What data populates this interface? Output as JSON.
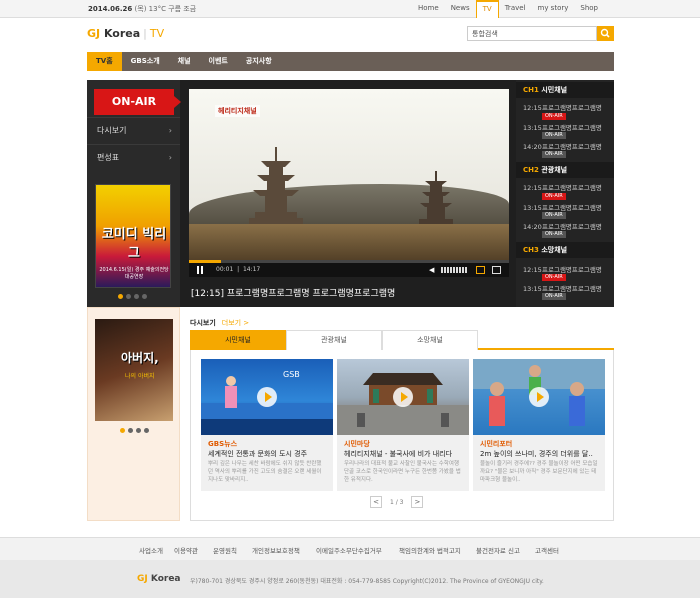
{
  "topbar": {
    "date": "2014.06.26",
    "weather": "(목) 13°C 구름 조금",
    "nav": [
      "Home",
      "News",
      "TV",
      "Travel",
      "my story",
      "Shop"
    ],
    "active": "TV"
  },
  "header": {
    "logo_gj": "GJ",
    "logo_korea": "Korea",
    "logo_sep": "|",
    "logo_tv": "TV",
    "search_placeholder": "통합검색"
  },
  "gnb": [
    "TV홈",
    "GBS소개",
    "채널",
    "이벤트",
    "공지사항"
  ],
  "player": {
    "onair_label": "ON-AIR",
    "menu": [
      "다시보기",
      "편성표"
    ],
    "arrow": "›",
    "poster_title": "코미디 빅리그",
    "poster_info": "2014.6.15(일) 경주 예술의전당 대공연장",
    "video_watermark": "헤리티지채널",
    "current_time": "00:01",
    "total_time": "14:17",
    "progress": 0.1,
    "now_title": "[12:15] 프로그램명프로그램명 프로그램명프로그램명"
  },
  "schedule": [
    {
      "ch": "CH1",
      "name": "시민채널",
      "items": [
        {
          "time": "12:15",
          "title": "프로그램명프로그램명",
          "badge": "ON-AIR",
          "live": true
        },
        {
          "time": "13:15",
          "title": "프로그램명프로그램명",
          "badge": "ON-AIR",
          "live": false
        },
        {
          "time": "14:20",
          "title": "프로그램명프로그램명",
          "badge": "ON-AIR",
          "live": false
        }
      ]
    },
    {
      "ch": "CH2",
      "name": "관광채널",
      "items": [
        {
          "time": "12:15",
          "title": "프로그램명프로그램명",
          "badge": "ON-AIR",
          "live": true
        },
        {
          "time": "13:15",
          "title": "프로그램명프로그램명",
          "badge": "ON-AIR",
          "live": false
        },
        {
          "time": "14:20",
          "title": "프로그램명프로그램명",
          "badge": "ON-AIR",
          "live": false
        }
      ]
    },
    {
      "ch": "CH3",
      "name": "소망채널",
      "items": [
        {
          "time": "12:15",
          "title": "프로그램명프로그램명",
          "badge": "ON-AIR",
          "live": true
        },
        {
          "time": "13:15",
          "title": "프로그램명프로그램명",
          "badge": "ON-AIR",
          "live": false
        }
      ]
    }
  ],
  "promo": {
    "title": "아버지,",
    "subtitle": "나의 아버지"
  },
  "replay": {
    "heading": "다시보기",
    "more": "더보기 >",
    "tabs": [
      "시민채널",
      "관광채널",
      "소망채널"
    ],
    "active_tab": 0,
    "cards": [
      {
        "category": "GBS뉴스",
        "title": "세계적인 전통과 문화의 도시 경주",
        "desc": "뿌리 깊은 나무는 세찬 바람에도 쉬지 않듯 찬란했던 역사의 뿌리를 가진 고도의 숨결은 오랜 세월이 지나도 맞바리지.."
      },
      {
        "category": "시민마당",
        "title": "헤리티지채널 - 불국사에 비가 내리다",
        "desc": "우리나라의 대표적 불교 사찰인 불국사는 수학여행 단골 코스로 한국인이라면 누구든 한번쯤 가봤을 법한 유적지다."
      },
      {
        "category": "시민리포터",
        "title": "2m 높이의 쓰나미, 경주의 더위를 달..",
        "desc": "물놀이 즐기러 경주에?? 경주 물놀이장 어떤 모습일까요? \"물은 보니까 아직\" 경주 보문단지에 있는 테마파크형 물놀이.."
      }
    ],
    "pager": "1 / 3",
    "prev": "<",
    "next": ">"
  },
  "footer": {
    "links": [
      "사업소개",
      "이용약관",
      "운영원칙",
      "개인정보보호정책",
      "이메일주소무단수집거부",
      "책임의한계와 법적고지",
      "불건전자료 신고",
      "고객센터"
    ],
    "logo_gj": "GJ",
    "logo_korea": "Korea",
    "address": "우)780-701 경상북도 경주시 양정로 260(동천동) 대표전화 : 054-779-8585   Copyright(C)2012. The Province of GYEONGJU city."
  }
}
